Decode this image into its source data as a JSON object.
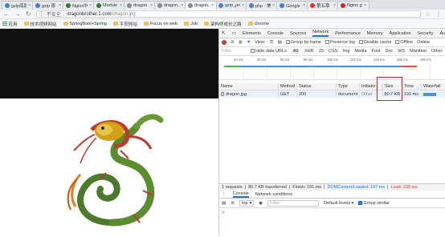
{
  "tabs": [
    {
      "title": "gzip底层",
      "color": "#4a7bd0"
    },
    {
      "title": "gzip 那",
      "color": "#4a7bd0"
    },
    {
      "title": "Nginx中",
      "color": "#2e7d32"
    },
    {
      "title": "Module",
      "color": "#2e7d32"
    },
    {
      "title": "dragon",
      "color": "#8a8a8a"
    },
    {
      "title": "dragon.",
      "color": "#8a8a8a"
    },
    {
      "title": "dragon.jp",
      "color": "#8a8a8a"
    },
    {
      "title": "gzip_pro",
      "color": "#4a7bd0"
    },
    {
      "title": "php - 美",
      "color": "#4a7bd0"
    },
    {
      "title": "Google 翻",
      "color": "#4a7bd0"
    },
    {
      "title": "第五章",
      "color": "#d33"
    },
    {
      "title": "Nginx gzi",
      "color": "#c62828"
    }
  ],
  "address": {
    "insecure": "不安全",
    "host": "dragonbrother.1.com",
    "path": "/dragon.jpg"
  },
  "bookmarks": [
    "应用",
    "技术视频网站",
    "SpringBoot+Spring",
    "平安网站",
    "Focus on web",
    "Job",
    "架构师成长之路",
    "chrome"
  ],
  "devtools": {
    "tabs": [
      "Elements",
      "Console",
      "Sources",
      "Network",
      "Performance",
      "Memory",
      "Application",
      "Security",
      "Audits"
    ],
    "selected_tab": "Network",
    "toolbar": {
      "view": "View:",
      "group_by_frame": "Group by frame",
      "preserve_log": "Preserve log",
      "disable_cache": "Disable cache",
      "offline": "Offline",
      "online": "Online"
    },
    "filter": {
      "placeholder": "Filter",
      "hide_data_urls": "Hide data URLs",
      "types": [
        "All",
        "XHR",
        "JS",
        "CSS",
        "Img",
        "Media",
        "Font",
        "Doc",
        "WS",
        "Manifest",
        "Other"
      ],
      "selected_type": "All"
    },
    "timeline_ticks": [
      "20 ms",
      "40 ms",
      "60 ms",
      "80 ms",
      "100 ms",
      "120 ms",
      "140 ms",
      "160 ms",
      "180 ms"
    ],
    "columns": [
      "Name",
      "Method",
      "Status",
      "Type",
      "Initiator",
      "Size",
      "Time",
      "Waterfall"
    ],
    "row": {
      "name": "dragon.jpg",
      "method": "GET",
      "status": "200",
      "type": "document",
      "initiator": "Other",
      "size": "80.7 KB",
      "time": "191 ms"
    },
    "status_bar": {
      "requests": "1 requests",
      "transferred": "80.7 KB transferred",
      "finish": "Finish: 191 ms",
      "dcl": "DOMContentLoaded: 197 ms",
      "load": "Load: 239 ms"
    },
    "drawer_tabs": [
      "Console",
      "Network conditions"
    ],
    "console": {
      "context": "top",
      "filter_placeholder": "Filter",
      "levels": "Default levels",
      "group_similar": "Group similar",
      "prompt": ">"
    }
  }
}
